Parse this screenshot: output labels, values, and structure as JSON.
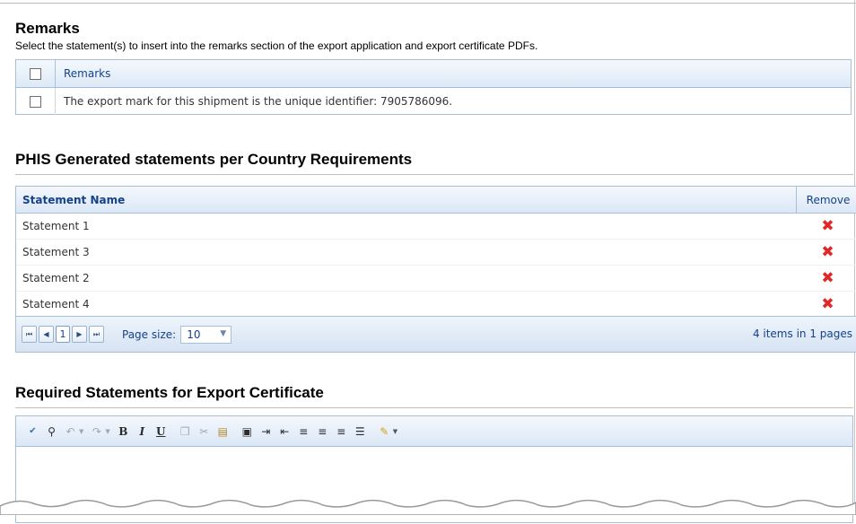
{
  "remarks": {
    "title": "Remarks",
    "description": "Select the statement(s) to insert into the remarks section of the export application and export certificate PDFs.",
    "header_label": "Remarks",
    "rows": [
      {
        "text": "The export mark for this shipment is the unique identifier: 7905786096.",
        "checked": false
      }
    ]
  },
  "phis": {
    "title": "PHIS Generated statements per Country Requirements",
    "columns": {
      "name": "Statement Name",
      "remove": "Remove"
    },
    "rows": [
      {
        "name": "Statement 1"
      },
      {
        "name": "Statement 3"
      },
      {
        "name": "Statement 2"
      },
      {
        "name": "Statement 4"
      }
    ],
    "pager": {
      "current_page": "1",
      "page_size_label": "Page size:",
      "page_size": "10",
      "items_info": "4 items in 1 pages"
    }
  },
  "required": {
    "title": "Required Statements for Export Certificate",
    "toolbar_icons": [
      "spellcheck-icon",
      "find-icon",
      "undo-icon",
      "redo-icon",
      "bold-icon",
      "italic-icon",
      "underline-icon",
      "copy-icon",
      "cut-icon",
      "paste-icon",
      "paste-special-icon",
      "indent-icon",
      "outdent-icon",
      "align-left-icon",
      "align-center-icon",
      "align-right-icon",
      "numbered-list-icon",
      "format-stripper-icon"
    ],
    "bold_glyph": "B",
    "italic_glyph": "I",
    "underline_glyph": "U"
  },
  "colors": {
    "header_text": "#15428b",
    "grid_border": "#a9bfd6",
    "remove_icon": "#e02828"
  }
}
